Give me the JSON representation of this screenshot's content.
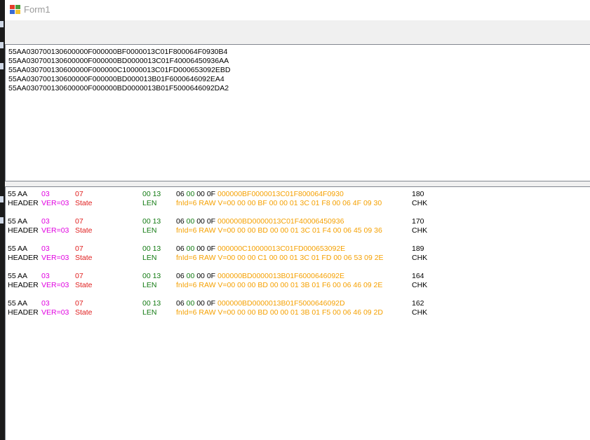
{
  "window": {
    "title": "Form1"
  },
  "raw_lines": [
    "55AA030700130600000F000000BF0000013C01F800064F0930B4",
    "55AA030700130600000F000000BD0000013C01F40006450936AA",
    "55AA030700130600000F000000C10000013C01FD000653092EBD",
    "55AA030700130600000F000000BD000013B01F6000646092EA4",
    "55AA030700130600000F000000BD0000013B01F5000646092DA2"
  ],
  "frames": [
    {
      "header": "55 AA",
      "header_label": "HEADER",
      "ver": "03",
      "ver_label": "VER=03",
      "state": "07",
      "state_label": "State",
      "len": "00 13",
      "len_label": "LEN",
      "fn_pre": "06",
      "fn_mid": "00",
      "fn_post": "00 0F",
      "payload": "000000BF0000013C01F800064F0930",
      "raw_label": "fnId=6 RAW V=00 00 00 BF 00 00 01 3C 01 F8 00 06 4F 09 30",
      "chk": "180",
      "chk_label": "CHK"
    },
    {
      "header": "55 AA",
      "header_label": "HEADER",
      "ver": "03",
      "ver_label": "VER=03",
      "state": "07",
      "state_label": "State",
      "len": "00 13",
      "len_label": "LEN",
      "fn_pre": "06",
      "fn_mid": "00",
      "fn_post": "00 0F",
      "payload": "000000BD0000013C01F40006450936",
      "raw_label": "fnId=6 RAW V=00 00 00 BD 00 00 01 3C 01 F4 00 06 45 09 36",
      "chk": "170",
      "chk_label": "CHK"
    },
    {
      "header": "55 AA",
      "header_label": "HEADER",
      "ver": "03",
      "ver_label": "VER=03",
      "state": "07",
      "state_label": "State",
      "len": "00 13",
      "len_label": "LEN",
      "fn_pre": "06",
      "fn_mid": "00",
      "fn_post": "00 0F",
      "payload": "000000C10000013C01FD000653092E",
      "raw_label": "fnId=6 RAW V=00 00 00 C1 00 00 01 3C 01 FD 00 06 53 09 2E",
      "chk": "189",
      "chk_label": "CHK"
    },
    {
      "header": "55 AA",
      "header_label": "HEADER",
      "ver": "03",
      "ver_label": "VER=03",
      "state": "07",
      "state_label": "State",
      "len": "00 13",
      "len_label": "LEN",
      "fn_pre": "06",
      "fn_mid": "00",
      "fn_post": "00 0F",
      "payload": "000000BD0000013B01F6000646092E",
      "raw_label": "fnId=6 RAW V=00 00 00 BD 00 00 01 3B 01 F6 00 06 46 09 2E",
      "chk": "164",
      "chk_label": "CHK"
    },
    {
      "header": "55 AA",
      "header_label": "HEADER",
      "ver": "03",
      "ver_label": "VER=03",
      "state": "07",
      "state_label": "State",
      "len": "00 13",
      "len_label": "LEN",
      "fn_pre": "06",
      "fn_mid": "00",
      "fn_post": "00 0F",
      "payload": "000000BD0000013B01F5000646092D",
      "raw_label": "fnId=6 RAW V=00 00 00 BD 00 00 01 3B 01 F5 00 06 46 09 2D",
      "chk": "162",
      "chk_label": "CHK"
    }
  ],
  "colors": {
    "header": "#000000",
    "ver": "#e000e0",
    "state": "#e01e1e",
    "len": "#127a12",
    "payload": "#f5a000",
    "chk": "#000000"
  },
  "icons": {
    "app": "app-form-icon"
  }
}
